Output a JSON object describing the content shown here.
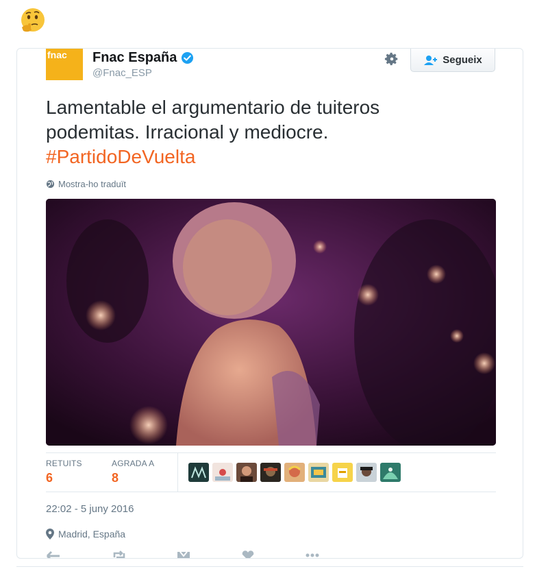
{
  "emoji": {
    "icon": "thinking-face-emoji"
  },
  "tweet": {
    "author_name": "Fnac España",
    "handle": "@Fnac_ESP",
    "avatar_logo": "fnac",
    "follow_label": "Segueix",
    "text_line1": "Lamentable el argumentario de tuiteros",
    "text_line2": "podemitas. Irracional y mediocre.",
    "hashtag": "#PartidoDeVuelta",
    "translate_label": "Mostra-ho traduït",
    "stats": {
      "retweets_label": "RETUITS",
      "retweets_value": "6",
      "likes_label": "AGRADA A",
      "likes_value": "8"
    },
    "timestamp": "22:02 - 5 juny 2016",
    "location": "Madrid, España"
  },
  "colors": {
    "accent": "#f26522",
    "brand_fnac": "#f5b21a",
    "verified": "#1da1f2",
    "follow_icon": "#1da1f2"
  }
}
